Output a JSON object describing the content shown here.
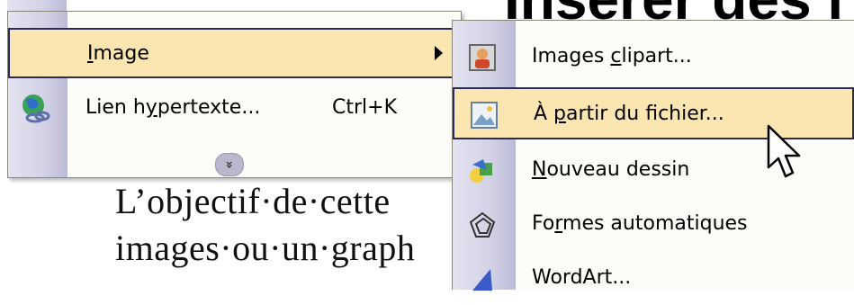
{
  "document": {
    "title_fragment": "Insérer des i",
    "body_line1": "L’objectif·de·cette",
    "body_line2": "images·ou·un·graph"
  },
  "menu": {
    "items": [
      {
        "pre": "",
        "ul": "I",
        "post": "mage",
        "shortcut": "",
        "has_submenu": true,
        "highlighted": true
      },
      {
        "pre": "Lien h",
        "ul": "y",
        "post": "pertexte...",
        "shortcut": "Ctrl+K",
        "icon": "hyperlink-globe-icon"
      }
    ],
    "expand_glyph": "»"
  },
  "submenu": {
    "items": [
      {
        "pre": "Images ",
        "ul": "c",
        "post": "lipart...",
        "icon": "clipart-icon"
      },
      {
        "pre": "À ",
        "ul": "p",
        "post": "artir du fichier...",
        "icon": "picture-file-icon",
        "highlighted": true
      },
      {
        "pre": "",
        "ul": "N",
        "post": "ouveau dessin",
        "icon": "drawing-icon"
      },
      {
        "pre": "Fo",
        "ul": "r",
        "post": "mes automatiques",
        "icon": "autoshapes-icon"
      },
      {
        "pre": "WordArt...",
        "ul": "",
        "post": "",
        "icon": "wordart-icon"
      }
    ]
  },
  "colors": {
    "highlight": "#fbe6b2",
    "highlight_border": "#2b2b5b",
    "gutter": "#d3d2e6"
  }
}
